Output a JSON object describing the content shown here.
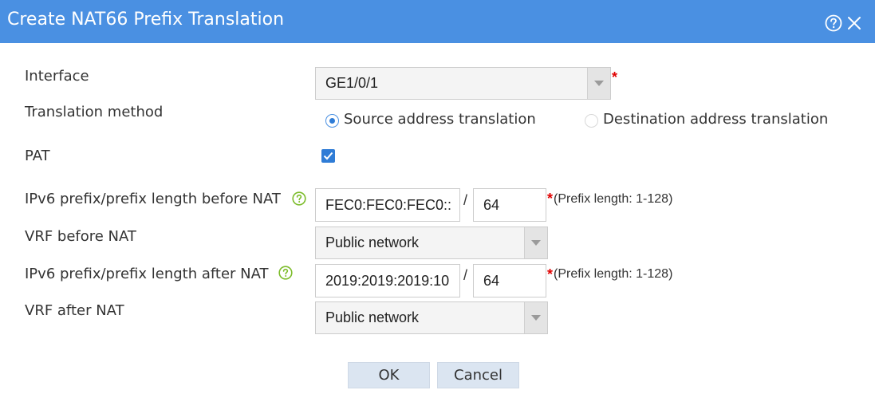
{
  "dialog": {
    "title": "Create NAT66 Prefix Translation",
    "help_icon": "help-circle-icon",
    "close_icon": "close-icon"
  },
  "form": {
    "interface": {
      "label": "Interface",
      "value": "GE1/0/1",
      "required": "*"
    },
    "translation_method": {
      "label": "Translation method",
      "options": [
        {
          "label": "Source address translation",
          "selected": true
        },
        {
          "label": "Destination address translation",
          "selected": false
        }
      ]
    },
    "pat": {
      "label": "PAT",
      "checked": true
    },
    "prefix_before": {
      "label": "IPv6 prefix/prefix length before NAT",
      "prefix_value": "FEC0:FEC0:FEC0::",
      "separator": "/",
      "length_value": "64",
      "required": "*",
      "hint": "(Prefix length: 1-128)"
    },
    "vrf_before": {
      "label": "VRF before NAT",
      "value": "Public network"
    },
    "prefix_after": {
      "label": "IPv6 prefix/prefix length after NAT",
      "prefix_value": "2019:2019:2019:10",
      "separator": "/",
      "length_value": "64",
      "required": "*",
      "hint": "(Prefix length: 1-128)"
    },
    "vrf_after": {
      "label": "VRF after NAT",
      "value": "Public network"
    }
  },
  "buttons": {
    "ok": "OK",
    "cancel": "Cancel"
  },
  "colors": {
    "titlebar": "#4a90e2",
    "accent": "#2f7cd6",
    "required": "#e00000",
    "button_bg": "#dbe5f1",
    "help_green": "#7cbc2a"
  }
}
